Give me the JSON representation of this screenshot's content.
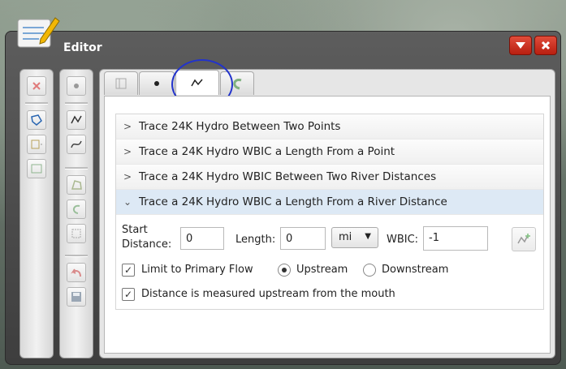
{
  "window": {
    "title": "Editor"
  },
  "titlebar": {
    "minimize_icon": "triangle-down-icon",
    "close_icon": "close-x-icon",
    "accent": "#d02a18"
  },
  "toolbar_left": {
    "tools": [
      "delete-icon",
      "polygon-select-icon",
      "split-icon",
      "merge-icon"
    ]
  },
  "toolbar_right": {
    "tools": [
      "point-icon",
      "polyline-icon",
      "reshape-icon",
      "polygon-icon",
      "curve-icon",
      "crop-icon",
      "undo-icon",
      "save-icon"
    ]
  },
  "tabs": [
    {
      "icon": "table-icon",
      "active": false
    },
    {
      "icon": "point-icon",
      "active": false
    },
    {
      "icon": "polyline-icon",
      "active": true
    },
    {
      "icon": "curve-icon",
      "active": false
    }
  ],
  "accordion": [
    {
      "label": "Trace 24K Hydro Between Two Points",
      "expanded": false
    },
    {
      "label": "Trace a 24K Hydro WBIC a Length From a Point",
      "expanded": false
    },
    {
      "label": "Trace a 24K Hydro WBIC Between Two River Distances",
      "expanded": false
    },
    {
      "label": "Trace a 24K Hydro WBIC a Length From a River Distance",
      "expanded": true
    }
  ],
  "form": {
    "start_distance_label_1": "Start",
    "start_distance_label_2": "Distance:",
    "start_distance_value": "0",
    "length_label": "Length:",
    "length_value": "0",
    "unit_value": "mi",
    "wbic_label": "WBIC:",
    "wbic_value": "-1",
    "limit_label": "Limit to Primary Flow",
    "limit_checked": true,
    "upstream_label": "Upstream",
    "upstream_selected": true,
    "downstream_label": "Downstream",
    "downstream_selected": false,
    "measured_label": "Distance is measured upstream from the mouth",
    "measured_checked": true
  }
}
